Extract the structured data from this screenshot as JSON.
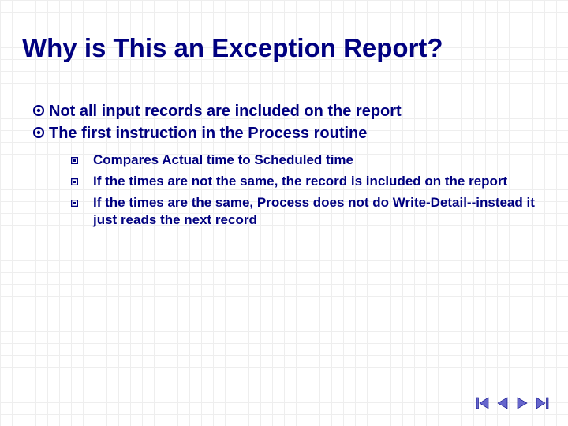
{
  "title": "Why is This an Exception Report?",
  "bullets": [
    {
      "text": "Not all input records are included on the report"
    },
    {
      "text": "The first instruction in the Process routine"
    }
  ],
  "subbullets": [
    {
      "text": "Compares Actual time to Scheduled time"
    },
    {
      "text": "If the times are not the same, the record is included on the report"
    },
    {
      "text": "If the times are the same, Process does not do Write-Detail--instead it just reads the next record"
    }
  ],
  "colors": {
    "primary": "#000080",
    "nav_fill": "#6666cc",
    "nav_stroke": "#000080"
  }
}
